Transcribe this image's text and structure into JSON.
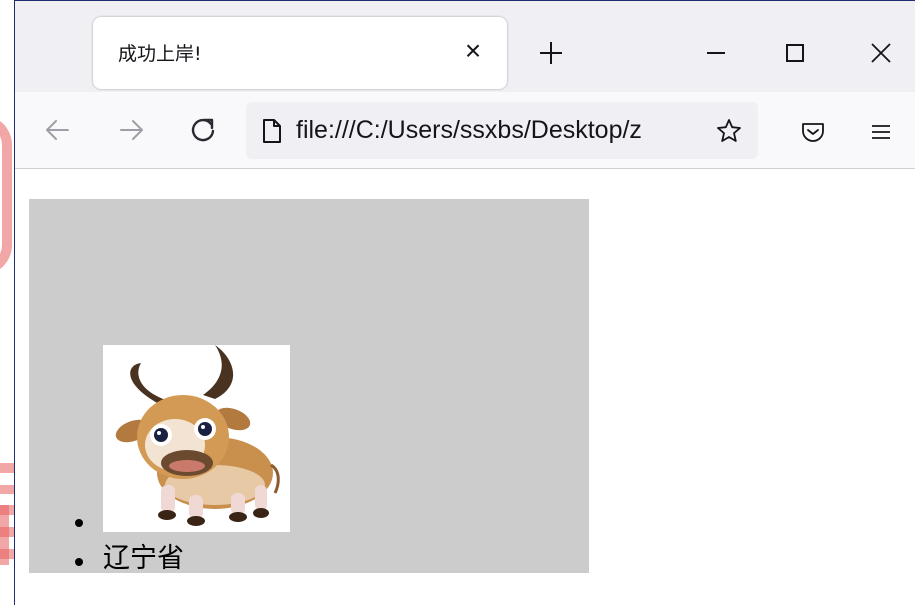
{
  "tab": {
    "title": "成功上岸!",
    "close_glyph": "×"
  },
  "toolbar": {
    "new_tab_icon": "plus-icon",
    "url": "file:///C:/Users/ssxbs/Desktop/z"
  },
  "page": {
    "list_items": [
      {
        "type": "image",
        "alt": "cow-image"
      },
      {
        "type": "text",
        "text": "辽宁省"
      }
    ],
    "background_color": "#cccccc"
  },
  "colors": {
    "tabstrip": "#f0f0f4",
    "navbar": "#f9f9fb",
    "urlbar": "#f0f0f4",
    "icon": "#5b5b66",
    "watermark": "#e85f5f"
  }
}
